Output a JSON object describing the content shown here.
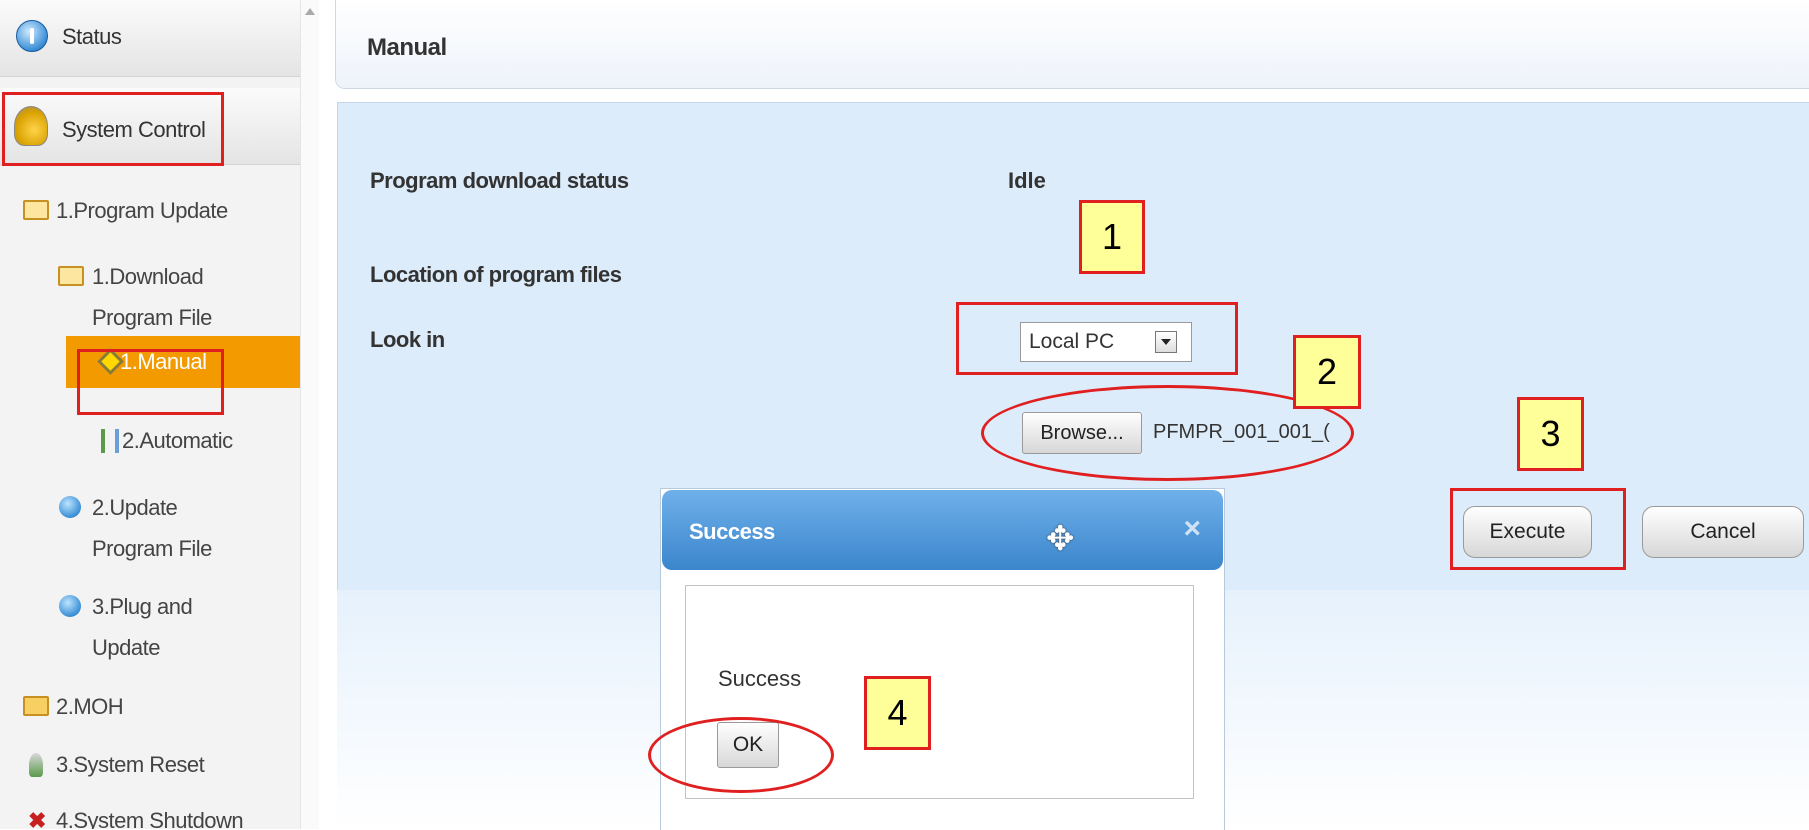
{
  "sidebar": {
    "status": "Status",
    "system_control": "System Control",
    "items": [
      {
        "label": "1.Program Update"
      },
      {
        "label": "1.Download"
      },
      {
        "label": "Program File"
      },
      {
        "label": "1.Manual"
      },
      {
        "label": "2.Automatic"
      },
      {
        "label": "2.Update"
      },
      {
        "label": "Program File"
      },
      {
        "label": "3.Plug and"
      },
      {
        "label": "Update"
      },
      {
        "label": "2.MOH"
      },
      {
        "label": "3.System Reset"
      },
      {
        "label": "4.System Shutdown"
      }
    ]
  },
  "header": {
    "title": "Manual"
  },
  "form": {
    "download_status_label": "Program download status",
    "download_status_value": "Idle",
    "location_label": "Location of program files",
    "lookin_label": "Look in",
    "lookin_value": "Local PC",
    "browse_label": "Browse...",
    "filename": "PFMPR_001_001_("
  },
  "actions": {
    "execute": "Execute",
    "cancel": "Cancel"
  },
  "dialog": {
    "title": "Success",
    "message": "Success",
    "ok": "OK",
    "close_glyph": "×"
  },
  "annotations": {
    "callouts": [
      "1",
      "2",
      "3",
      "4"
    ],
    "color": "#e02020",
    "callout_fill": "#ffff9a"
  },
  "colors": {
    "selected_item": "#f29a00",
    "dialog_title": "#3b86cc",
    "content_bg": "#ddecfa"
  }
}
